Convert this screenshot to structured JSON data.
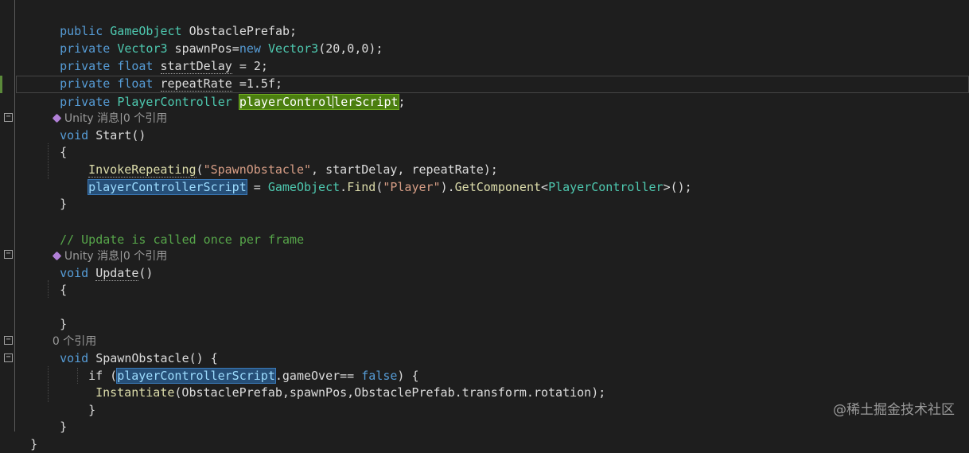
{
  "editor": {
    "lines": {
      "l1": [
        "public",
        " ",
        "GameObject",
        " ObstaclePrefab;"
      ],
      "l2": [
        "private",
        " ",
        "Vector3",
        " spawnPos=",
        "new",
        " ",
        "Vector3",
        "(20,0,0);"
      ],
      "l3": [
        "private",
        " ",
        "float",
        " ",
        "startDelay",
        " = 2;"
      ],
      "l4": [
        "private",
        " ",
        "float",
        " ",
        "repeatRate",
        " =1.5f;"
      ],
      "l5": [
        "private",
        " ",
        "PlayerController",
        " ",
        "playerControl",
        "lerScript",
        ";"
      ],
      "lens1": "Unity 消息|0 个引用",
      "l6": [
        "void",
        " ",
        "Start",
        "()"
      ],
      "l7": "{",
      "l8": [
        "InvokeRepeating",
        "(",
        "\"SpawnObstacle\"",
        ", startDelay, repeatRate);"
      ],
      "l9": [
        "playerControllerScript",
        " = ",
        "GameObject",
        ".",
        "Find",
        "(",
        "\"Player\"",
        ").",
        "GetComponent",
        "<",
        "PlayerController",
        ">();"
      ],
      "l10": "}",
      "l11": "// Update is called once per frame",
      "lens2": "Unity 消息|0 个引用",
      "l12": [
        "void",
        " ",
        "Update",
        "()"
      ],
      "l13": "{",
      "l14": "}",
      "lens3": "0 个引用",
      "l15": [
        "void",
        " ",
        "SpawnObstacle",
        "() {"
      ],
      "l16": [
        "if",
        " (",
        "playerControllerScript",
        ".gameOver== ",
        "false",
        ") {"
      ],
      "l17": [
        "Instantiate",
        "(ObstaclePrefab,spawnPos,ObstaclePrefab.transform.rotation);"
      ],
      "l18": "}",
      "l19": "}",
      "l20": "}"
    }
  },
  "watermark": "@稀土掘金技术社区",
  "icons": {
    "collapse": "minus-box-icon",
    "codelens": "unity-cube-icon"
  }
}
